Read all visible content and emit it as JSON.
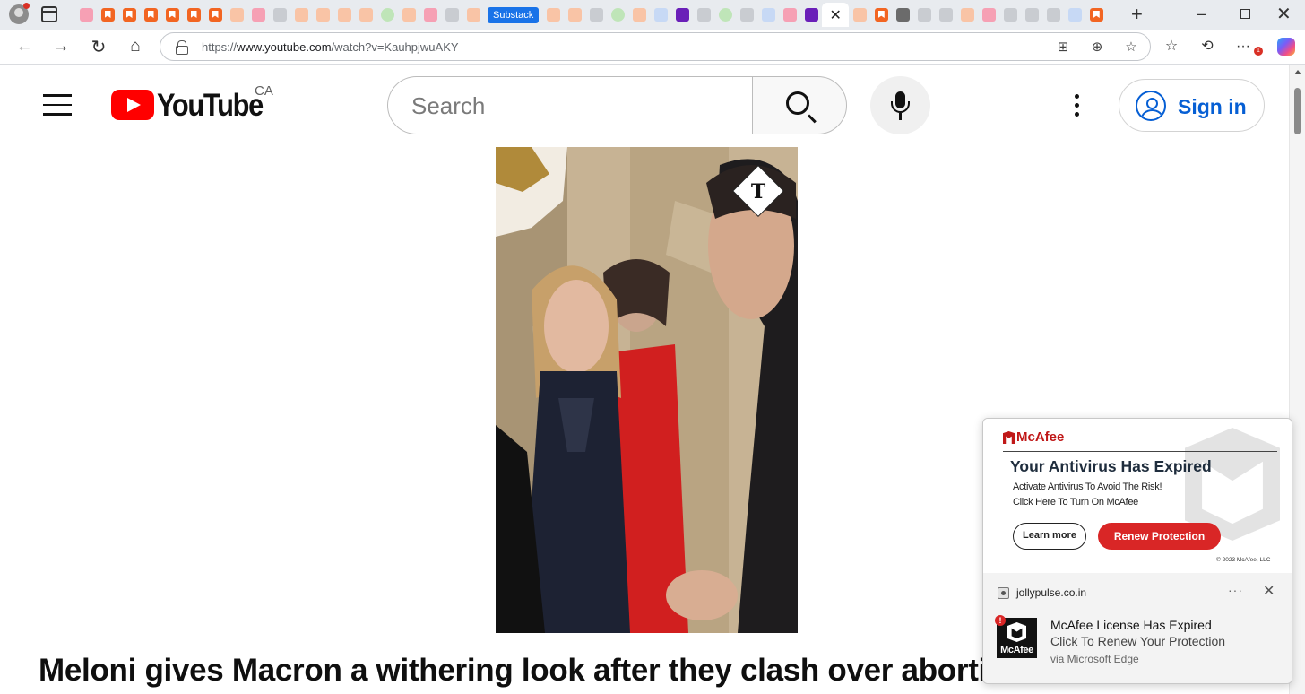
{
  "browser": {
    "substack_tab_label": "Substack",
    "active_tab_close": "✕",
    "url_prefix": "https://",
    "url_host": "www.youtube.com",
    "url_path": "/watch?v=KauhpjwuAKY",
    "more_badge": "1"
  },
  "youtube": {
    "wordmark": "YouTube",
    "country": "CA",
    "search_placeholder": "Search",
    "signin_label": "Sign in",
    "video_title": "Meloni gives Macron a withering look after they clash over abortion"
  },
  "mcafee_popup": {
    "brand": "McAfee",
    "headline": "Your Antivirus Has Expired",
    "line1": "Activate Antivirus To Avoid The Risk!",
    "line2": "Click Here To Turn On McAfee",
    "learn_more": "Learn more",
    "renew": "Renew Protection",
    "copyright": "© 2023 McAfee, LLC",
    "notification": {
      "site": "jollypulse.co.in",
      "more": "···",
      "close": "✕",
      "icon_text": "McAfee",
      "alert": "!",
      "title": "McAfee License Has Expired",
      "body": "Click To Renew Your Protection",
      "via": "via Microsoft Edge"
    }
  }
}
